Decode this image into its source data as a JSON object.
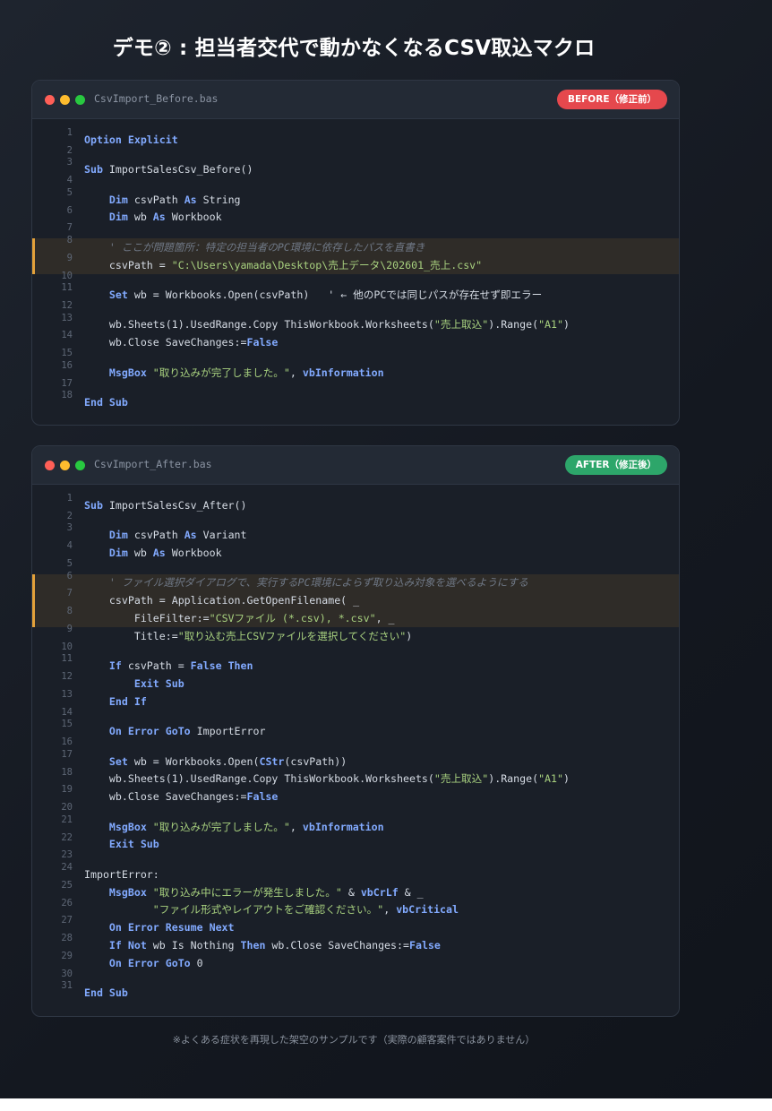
{
  "page_title": "デモ② : 担当者交代で動かなくなるCSV取込マクロ",
  "footer_note": "※よくある症状を再現した架空のサンプルです（実際の顧客案件ではありません）",
  "colors": {
    "keyword": "#82aaff",
    "string": "#a8d17f",
    "comment": "#6f7886",
    "highlight_bar": "#e3a13a",
    "badge_before": "#e5484d",
    "badge_after": "#2da66a"
  },
  "windows": [
    {
      "id": "win-before",
      "filename": "CsvImport_Before.bas",
      "badge": "BEFORE（修正前）",
      "badge_type": "before",
      "lines": [
        {
          "n": "1",
          "blank": false,
          "hl": false,
          "tokens": [
            {
              "t": "kw",
              "v": "Option Explicit"
            }
          ]
        },
        {
          "n": "2",
          "blank": true,
          "hl": false,
          "tokens": []
        },
        {
          "n": "3",
          "blank": false,
          "hl": false,
          "tokens": [
            {
              "t": "kw",
              "v": "Sub"
            },
            {
              "t": "",
              "v": " ImportSalesCsv_Before()"
            }
          ]
        },
        {
          "n": "4",
          "blank": true,
          "hl": false,
          "tokens": []
        },
        {
          "n": "5",
          "blank": false,
          "hl": false,
          "tokens": [
            {
              "t": "",
              "v": "    "
            },
            {
              "t": "kw",
              "v": "Dim"
            },
            {
              "t": "",
              "v": " csvPath "
            },
            {
              "t": "kw",
              "v": "As"
            },
            {
              "t": "",
              "v": " String"
            }
          ]
        },
        {
          "n": "6",
          "blank": false,
          "hl": false,
          "tokens": [
            {
              "t": "",
              "v": "    "
            },
            {
              "t": "kw",
              "v": "Dim"
            },
            {
              "t": "",
              "v": " wb "
            },
            {
              "t": "kw",
              "v": "As"
            },
            {
              "t": "",
              "v": " Workbook"
            }
          ]
        },
        {
          "n": "7",
          "blank": true,
          "hl": false,
          "tokens": []
        },
        {
          "n": "8",
          "blank": false,
          "hl": true,
          "tokens": [
            {
              "t": "",
              "v": "    "
            },
            {
              "t": "cm",
              "v": "' ここが問題箇所：特定の担当者のPC環境に依存したパスを直書き"
            }
          ]
        },
        {
          "n": "9",
          "blank": false,
          "hl": true,
          "tokens": [
            {
              "t": "",
              "v": "    csvPath = "
            },
            {
              "t": "str",
              "v": "\"C:\\Users\\yamada\\Desktop\\売上データ\\202601_売上.csv\""
            }
          ]
        },
        {
          "n": "10",
          "blank": true,
          "hl": false,
          "tokens": []
        },
        {
          "n": "11",
          "blank": false,
          "hl": false,
          "tokens": [
            {
              "t": "",
              "v": "    "
            },
            {
              "t": "kw",
              "v": "Set"
            },
            {
              "t": "",
              "v": " wb = Workbooks.Open(csvPath)   ' ← 他のPCでは同じパスが存在せず即エラー"
            }
          ]
        },
        {
          "n": "12",
          "blank": true,
          "hl": false,
          "tokens": []
        },
        {
          "n": "13",
          "blank": false,
          "hl": false,
          "tokens": [
            {
              "t": "",
              "v": "    wb.Sheets(1).UsedRange.Copy ThisWorkbook.Worksheets("
            },
            {
              "t": "str",
              "v": "\"売上取込\""
            },
            {
              "t": "",
              "v": ").Range("
            },
            {
              "t": "str",
              "v": "\"A1\""
            },
            {
              "t": "",
              "v": ")"
            }
          ]
        },
        {
          "n": "14",
          "blank": false,
          "hl": false,
          "tokens": [
            {
              "t": "",
              "v": "    wb.Close SaveChanges:="
            },
            {
              "t": "kw",
              "v": "False"
            }
          ]
        },
        {
          "n": "15",
          "blank": true,
          "hl": false,
          "tokens": []
        },
        {
          "n": "16",
          "blank": false,
          "hl": false,
          "tokens": [
            {
              "t": "",
              "v": "    "
            },
            {
              "t": "kw",
              "v": "MsgBox"
            },
            {
              "t": "",
              "v": " "
            },
            {
              "t": "str",
              "v": "\"取り込みが完了しました。\""
            },
            {
              "t": "",
              "v": ", "
            },
            {
              "t": "kw",
              "v": "vbInformation"
            }
          ]
        },
        {
          "n": "17",
          "blank": true,
          "hl": false,
          "tokens": []
        },
        {
          "n": "18",
          "blank": false,
          "hl": false,
          "tokens": [
            {
              "t": "kw",
              "v": "End Sub"
            }
          ]
        }
      ]
    },
    {
      "id": "win-after",
      "filename": "CsvImport_After.bas",
      "badge": "AFTER（修正後）",
      "badge_type": "after",
      "lines": [
        {
          "n": "1",
          "blank": false,
          "hl": false,
          "tokens": [
            {
              "t": "kw",
              "v": "Sub"
            },
            {
              "t": "",
              "v": " ImportSalesCsv_After()"
            }
          ]
        },
        {
          "n": "2",
          "blank": true,
          "hl": false,
          "tokens": []
        },
        {
          "n": "3",
          "blank": false,
          "hl": false,
          "tokens": [
            {
              "t": "",
              "v": "    "
            },
            {
              "t": "kw",
              "v": "Dim"
            },
            {
              "t": "",
              "v": " csvPath "
            },
            {
              "t": "kw",
              "v": "As"
            },
            {
              "t": "",
              "v": " Variant"
            }
          ]
        },
        {
          "n": "4",
          "blank": false,
          "hl": false,
          "tokens": [
            {
              "t": "",
              "v": "    "
            },
            {
              "t": "kw",
              "v": "Dim"
            },
            {
              "t": "",
              "v": " wb "
            },
            {
              "t": "kw",
              "v": "As"
            },
            {
              "t": "",
              "v": " Workbook"
            }
          ]
        },
        {
          "n": "5",
          "blank": true,
          "hl": false,
          "tokens": []
        },
        {
          "n": "6",
          "blank": false,
          "hl": true,
          "tokens": [
            {
              "t": "",
              "v": "    "
            },
            {
              "t": "cm",
              "v": "' ファイル選択ダイアログで、実行するPC環境によらず取り込み対象を選べるようにする"
            }
          ]
        },
        {
          "n": "7",
          "blank": false,
          "hl": true,
          "tokens": [
            {
              "t": "",
              "v": "    csvPath = Application.GetOpenFilename( _"
            }
          ]
        },
        {
          "n": "8",
          "blank": false,
          "hl": true,
          "tokens": [
            {
              "t": "",
              "v": "        FileFilter:="
            },
            {
              "t": "str",
              "v": "\"CSVファイル (*.csv), *.csv\""
            },
            {
              "t": "",
              "v": ", _"
            }
          ]
        },
        {
          "n": "9",
          "blank": false,
          "hl": false,
          "tokens": [
            {
              "t": "",
              "v": "        Title:="
            },
            {
              "t": "str",
              "v": "\"取り込む売上CSVファイルを選択してください\""
            },
            {
              "t": "",
              "v": ")"
            }
          ]
        },
        {
          "n": "10",
          "blank": true,
          "hl": false,
          "tokens": []
        },
        {
          "n": "11",
          "blank": false,
          "hl": false,
          "tokens": [
            {
              "t": "",
              "v": "    "
            },
            {
              "t": "kw",
              "v": "If"
            },
            {
              "t": "",
              "v": " csvPath = "
            },
            {
              "t": "kw",
              "v": "False"
            },
            {
              "t": "",
              "v": " "
            },
            {
              "t": "kw",
              "v": "Then"
            }
          ]
        },
        {
          "n": "12",
          "blank": false,
          "hl": false,
          "tokens": [
            {
              "t": "",
              "v": "        "
            },
            {
              "t": "kw",
              "v": "Exit Sub"
            }
          ]
        },
        {
          "n": "13",
          "blank": false,
          "hl": false,
          "tokens": [
            {
              "t": "",
              "v": "    "
            },
            {
              "t": "kw",
              "v": "End If"
            }
          ]
        },
        {
          "n": "14",
          "blank": true,
          "hl": false,
          "tokens": []
        },
        {
          "n": "15",
          "blank": false,
          "hl": false,
          "tokens": [
            {
              "t": "",
              "v": "    "
            },
            {
              "t": "kw",
              "v": "On Error GoTo"
            },
            {
              "t": "",
              "v": " ImportError"
            }
          ]
        },
        {
          "n": "16",
          "blank": true,
          "hl": false,
          "tokens": []
        },
        {
          "n": "17",
          "blank": false,
          "hl": false,
          "tokens": [
            {
              "t": "",
              "v": "    "
            },
            {
              "t": "kw",
              "v": "Set"
            },
            {
              "t": "",
              "v": " wb = Workbooks.Open("
            },
            {
              "t": "kw",
              "v": "CStr"
            },
            {
              "t": "",
              "v": "(csvPath))"
            }
          ]
        },
        {
          "n": "18",
          "blank": false,
          "hl": false,
          "tokens": [
            {
              "t": "",
              "v": "    wb.Sheets(1).UsedRange.Copy ThisWorkbook.Worksheets("
            },
            {
              "t": "str",
              "v": "\"売上取込\""
            },
            {
              "t": "",
              "v": ").Range("
            },
            {
              "t": "str",
              "v": "\"A1\""
            },
            {
              "t": "",
              "v": ")"
            }
          ]
        },
        {
          "n": "19",
          "blank": false,
          "hl": false,
          "tokens": [
            {
              "t": "",
              "v": "    wb.Close SaveChanges:="
            },
            {
              "t": "kw",
              "v": "False"
            }
          ]
        },
        {
          "n": "20",
          "blank": true,
          "hl": false,
          "tokens": []
        },
        {
          "n": "21",
          "blank": false,
          "hl": false,
          "tokens": [
            {
              "t": "",
              "v": "    "
            },
            {
              "t": "kw",
              "v": "MsgBox"
            },
            {
              "t": "",
              "v": " "
            },
            {
              "t": "str",
              "v": "\"取り込みが完了しました。\""
            },
            {
              "t": "",
              "v": ", "
            },
            {
              "t": "kw",
              "v": "vbInformation"
            }
          ]
        },
        {
          "n": "22",
          "blank": false,
          "hl": false,
          "tokens": [
            {
              "t": "",
              "v": "    "
            },
            {
              "t": "kw",
              "v": "Exit Sub"
            }
          ]
        },
        {
          "n": "23",
          "blank": true,
          "hl": false,
          "tokens": []
        },
        {
          "n": "24",
          "blank": false,
          "hl": false,
          "tokens": [
            {
              "t": "",
              "v": "ImportError:"
            }
          ]
        },
        {
          "n": "25",
          "blank": false,
          "hl": false,
          "tokens": [
            {
              "t": "",
              "v": "    "
            },
            {
              "t": "kw",
              "v": "MsgBox"
            },
            {
              "t": "",
              "v": " "
            },
            {
              "t": "str",
              "v": "\"取り込み中にエラーが発生しました。\""
            },
            {
              "t": "",
              "v": " & "
            },
            {
              "t": "kw",
              "v": "vbCrLf"
            },
            {
              "t": "",
              "v": " & _"
            }
          ]
        },
        {
          "n": "26",
          "blank": false,
          "hl": false,
          "tokens": [
            {
              "t": "",
              "v": "           "
            },
            {
              "t": "str",
              "v": "\"ファイル形式やレイアウトをご確認ください。\""
            },
            {
              "t": "",
              "v": ", "
            },
            {
              "t": "kw",
              "v": "vbCritical"
            }
          ]
        },
        {
          "n": "27",
          "blank": false,
          "hl": false,
          "tokens": [
            {
              "t": "",
              "v": "    "
            },
            {
              "t": "kw",
              "v": "On Error Resume Next"
            }
          ]
        },
        {
          "n": "28",
          "blank": false,
          "hl": false,
          "tokens": [
            {
              "t": "",
              "v": "    "
            },
            {
              "t": "kw",
              "v": "If Not"
            },
            {
              "t": "",
              "v": " wb Is Nothing "
            },
            {
              "t": "kw",
              "v": "Then"
            },
            {
              "t": "",
              "v": " wb.Close SaveChanges:="
            },
            {
              "t": "kw",
              "v": "False"
            }
          ]
        },
        {
          "n": "29",
          "blank": false,
          "hl": false,
          "tokens": [
            {
              "t": "",
              "v": "    "
            },
            {
              "t": "kw",
              "v": "On Error GoTo"
            },
            {
              "t": "",
              "v": " 0"
            }
          ]
        },
        {
          "n": "30",
          "blank": true,
          "hl": false,
          "tokens": []
        },
        {
          "n": "31",
          "blank": false,
          "hl": false,
          "tokens": [
            {
              "t": "kw",
              "v": "End Sub"
            }
          ]
        }
      ]
    }
  ]
}
